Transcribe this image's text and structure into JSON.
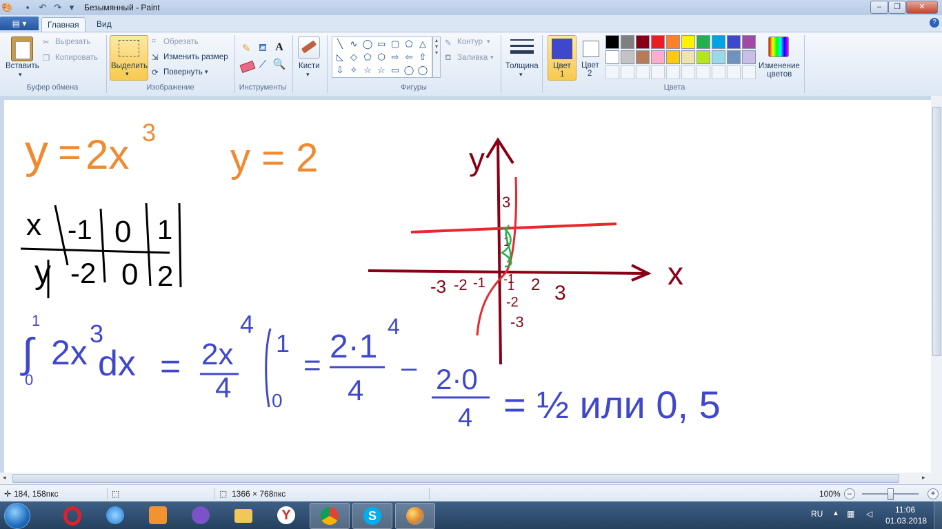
{
  "window": {
    "title": "Безымянный - Paint",
    "minimize_label": "–",
    "restore_label": "❐",
    "close_label": "✕"
  },
  "tabs": {
    "file_label": "▤ ▾",
    "home_label": "Главная",
    "view_label": "Вид",
    "help_icon": "help-icon"
  },
  "ribbon": {
    "clipboard": {
      "paste_label": "Вставить",
      "cut_label": "Вырезать",
      "copy_label": "Копировать",
      "group_label": "Буфер обмена"
    },
    "image": {
      "select_label": "Выделить",
      "crop_label": "Обрезать",
      "resize_label": "Изменить размер",
      "rotate_label": "Повернуть",
      "group_label": "Изображение"
    },
    "tools": {
      "group_label": "Инструменты",
      "icons": [
        "pencil-icon",
        "fill-icon",
        "text-icon",
        "eraser-icon",
        "color-picker-icon",
        "magnifier-icon"
      ]
    },
    "brushes": {
      "label": "Кисти"
    },
    "shapes": {
      "group_label": "Фигуры",
      "outline_label": "Контур",
      "fill_label": "Заливка",
      "glyphs": [
        "╲",
        "∿",
        "◯",
        "▭",
        "▢",
        "⬠",
        "△",
        "◺",
        "◇",
        "⬠",
        "⬡",
        "⇨",
        "⇦",
        "⇧",
        "⇩",
        "✧",
        "☆",
        "☆",
        "▭",
        "◯",
        "◯"
      ]
    },
    "size": {
      "label": "Толщина"
    },
    "colors": {
      "color1_label": "Цвет",
      "color1_num": "1",
      "color2_label": "Цвет",
      "color2_num": "2",
      "color1": "#3f48cc",
      "color2": "#ffffff",
      "group_label": "Цвета",
      "edit_label": "Изменение",
      "edit_label2": "цветов",
      "palette_row1": [
        "#000000",
        "#7f7f7f",
        "#880015",
        "#ed1c24",
        "#ff7f27",
        "#fff200",
        "#22b14c",
        "#00a2e8",
        "#3f48cc",
        "#a349a4"
      ],
      "palette_row2": [
        "#ffffff",
        "#c3c3c3",
        "#b97a57",
        "#ffaec9",
        "#ffc90e",
        "#efe4b0",
        "#b5e61d",
        "#99d9ea",
        "#7092be",
        "#c8bfe7"
      ]
    }
  },
  "canvas": {
    "ink_orange": "#f08a30",
    "ink_black": "#000000",
    "ink_dark_red": "#880015",
    "ink_red": "#e8282e",
    "ink_green": "#22b14c",
    "ink_blue": "#3f48cc",
    "eq1_y": "y",
    "eq1_eq": "=",
    "eq1_rhs": "2x",
    "eq1_exp": "3",
    "eq2": "y = 2",
    "table_x": "x",
    "table_y": "y",
    "table_x_vals": [
      "-1",
      "0",
      "1"
    ],
    "table_y_vals": [
      "-2",
      "0",
      "2"
    ],
    "graph_y_label": "y",
    "graph_x_label": "x",
    "graph_y_ticks": [
      "3",
      "1",
      "-1",
      "-2",
      "-3"
    ],
    "graph_x_ticks": [
      "-3",
      "-2",
      "-1",
      "1",
      "2",
      "3"
    ],
    "integral_upper": "1",
    "integral_lower": "0",
    "integrand": "2x",
    "integrand_exp": "3",
    "integrand_dx": "dx",
    "eq_sign": "=",
    "antideriv_num": "2x",
    "antideriv_exp": "4",
    "antideriv_den": "4",
    "bar_upper": "1",
    "bar_lower": "0",
    "frac1_num": "2·1",
    "frac1_exp": "4",
    "frac1_den": "4",
    "minus": "–",
    "frac2_num": "2·0",
    "frac2_den": "4",
    "result": "= ½ или 0, 5"
  },
  "status": {
    "cursor_pos": "184, 158пкс",
    "canvas_size": "1366 × 768пкс",
    "zoom": "100%",
    "zoom_percent": 100
  },
  "taskbar": {
    "lang": "RU",
    "time": "11:06",
    "date": "01.03.2018",
    "apps": [
      "opera-icon",
      "internet-explorer-icon",
      "media-player-icon",
      "viber-icon",
      "explorer-folder-icon",
      "yandex-browser-icon",
      "chrome-icon",
      "skype-icon",
      "paint-icon"
    ]
  }
}
